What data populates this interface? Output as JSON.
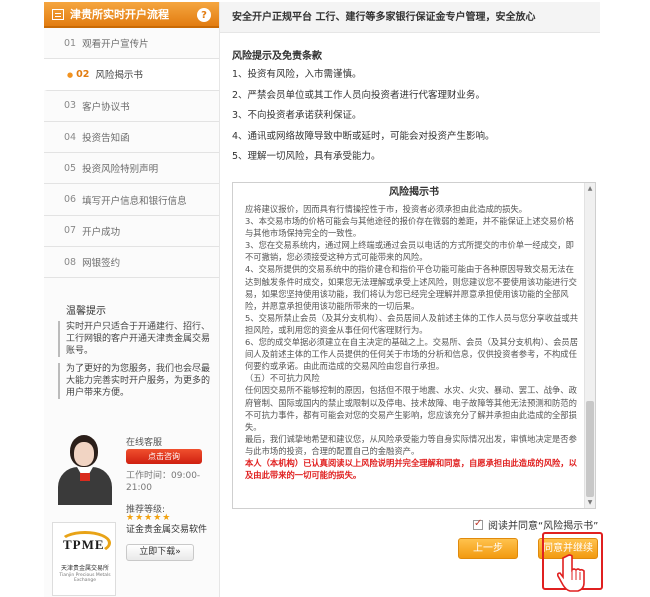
{
  "sidebar": {
    "title": "津贵所实时开户流程",
    "help": "?",
    "steps": [
      {
        "num": "01",
        "label": "观看开户宣传片"
      },
      {
        "num": "02",
        "label": "风险揭示书"
      },
      {
        "num": "03",
        "label": "客户协议书"
      },
      {
        "num": "04",
        "label": "投资告知函"
      },
      {
        "num": "05",
        "label": "投资风险特别声明"
      },
      {
        "num": "06",
        "label": "填写开户信息和银行信息"
      },
      {
        "num": "07",
        "label": "开户成功"
      },
      {
        "num": "08",
        "label": "网银签约"
      }
    ],
    "active_step": "02",
    "tips_title": "温馨提示",
    "tips": [
      "实时开户只适合于开通建行、招行、工行网银的客户开通天津贵金属交易账号。",
      "为了更好的为您服务，我们也会尽最大能力完善实时开户服务，为更多的用户带来方便。"
    ],
    "service": {
      "label": "在线客服",
      "chat_button": "点击咨询",
      "hours": "工作时间：09:00-21:00"
    },
    "software": {
      "rating_label": "推荐等级:",
      "stars": "★★★★★",
      "name": "证金贵金属交易软件",
      "download_button": "立即下载»",
      "logo_text": "TPME",
      "logo_cn": "天津贵金属交易所",
      "logo_en": "Tianjin Precious Metals Exchange"
    }
  },
  "main": {
    "banner": "安全开户正规平台  工行、建行等多家银行保证金专户管理，安全放心",
    "notice_title": "风险提示及免责条款",
    "risks": [
      "1、投资有风险，入市需谨慎。",
      "2、严禁会员单位或其工作人员向投资者进行代客理财业务。",
      "3、不向投资者承诺获利保证。",
      "4、通讯或网络故障导致中断或延时，可能会对投资产生影响。",
      "5、理解一切风险，具有承受能力。"
    ],
    "doc": {
      "title": "风险揭示书",
      "paragraphs": [
        "应将建议报价，因而具有行情操控性于市，投资者必须承担由此造成的损失。",
        "3、本交易市场的价格可能会与其他途径的报价存在微弱的差距，并不能保证上述交易价格与其他市场保持完全的一致性。",
        "3、您在交易系统内，通过网上终端或通过会员以电话的方式所提交的市价单一经成交，即不可撤销，您必须接受这种方式可能带来的风险。",
        "4、交易所提供的交易系统中的指价建仓和指价平仓功能可能由于各种原因导致交易无法在达到触发条件时成交，如果您无法理解或承受上述风险，则您建议您不要使用该功能进行交易，如果您坚持使用该功能，我们将认为您已经完全理解并愿意承担使用该功能的全部风险，并愿意承担使用该功能所带来的一切后果。",
        "5、交易所禁止会员（及其分支机构）、会员居间人及前述主体的工作人员与您分享收益或共担风险，或利用您的资金从事任何代客理财行为。",
        "6、您的成交单据必须建立在自主决定的基础之上。交易所、会员（及其分支机构）、会员居间人及前述主体的工作人员提供的任何关于市场的分析和信息，仅供投资者参考，不构成任何要约或承诺。由此而造成的交易风险由您自行承担。",
        "（五）不可抗力风险",
        "任何因交易所不能够控制的原因，包括但不限于地震、水灾、火灾、暴动、罢工、战争、政府管制、国际或国内的禁止或限制以及停电、技术故障、电子故障等其他无法预测和防范的不可抗力事件，都有可能会对您的交易产生影响，您应该充分了解并承担由此造成的全部损失。",
        "最后，我们诚挚地希望和建议您，从风险承受能力等自身实际情况出发，审慎地决定是否参与此市场的投资，合理的配置自己的金融资产。"
      ],
      "warning": "本人（本机构）已认真阅读以上风险说明并完全理解和同意，自愿承担由此造成的风险，以及由此带来的一切可能的损失。"
    },
    "agree_label": "阅读并同意“风险揭示书”",
    "prev_button": "上一步",
    "next_button": "同意并继续"
  },
  "colors": {
    "accent": "#f29a10",
    "header_orange": "#e27c10",
    "warning_red": "#e02020"
  }
}
